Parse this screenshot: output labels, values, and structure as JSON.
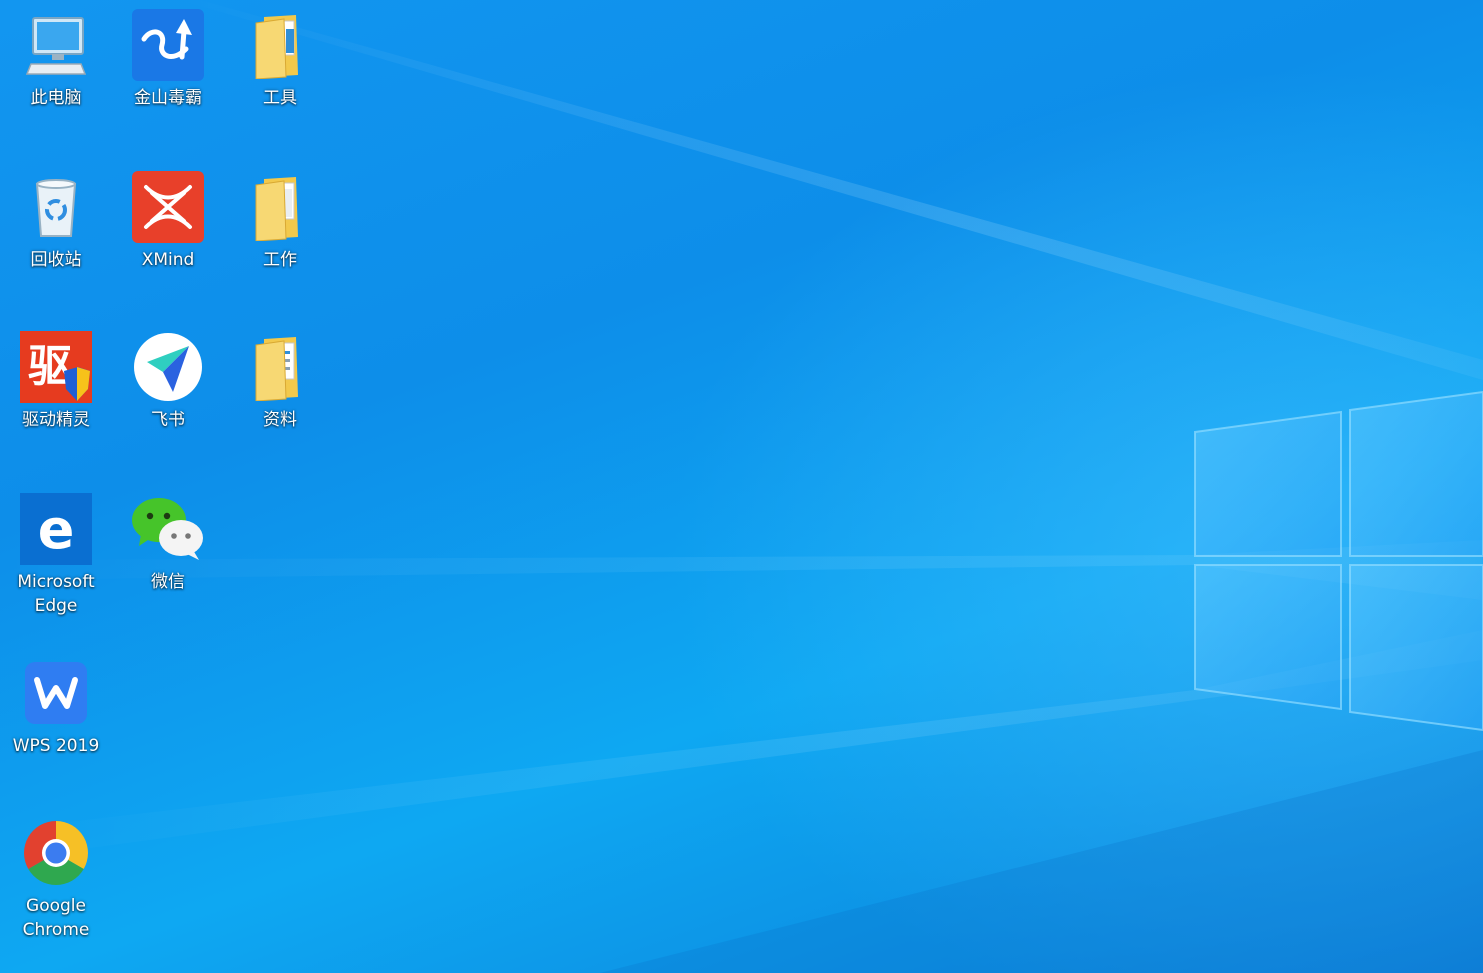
{
  "desktop": {
    "icons": [
      {
        "label": "此电脑",
        "icon": "computer-icon"
      },
      {
        "label": "金山毒霸",
        "icon": "kingsoft-antivirus-icon"
      },
      {
        "label": "工具",
        "icon": "folder-icon"
      },
      {
        "label": "回收站",
        "icon": "recycle-bin-icon"
      },
      {
        "label": "XMind",
        "icon": "xmind-icon"
      },
      {
        "label": "工作",
        "icon": "folder-icon"
      },
      {
        "label": "驱动精灵",
        "icon": "driver-genius-icon"
      },
      {
        "label": "飞书",
        "icon": "feishu-icon"
      },
      {
        "label": "资料",
        "icon": "folder-icon"
      },
      {
        "label": "Microsoft Edge",
        "icon": "edge-icon"
      },
      {
        "label": "微信",
        "icon": "wechat-icon"
      },
      {
        "label": "WPS 2019",
        "icon": "wps-icon"
      },
      {
        "label": "Google Chrome",
        "icon": "chrome-icon"
      }
    ]
  },
  "colors": {
    "wallpaper_blue": "#0d8ee9",
    "folder_yellow": "#f2c94c",
    "xmind_red": "#e8402a",
    "driver_red": "#e63b1f",
    "edge_blue": "#0a6fd1",
    "wechat_green": "#46c42a",
    "wps_blue": "#2f7df2"
  }
}
